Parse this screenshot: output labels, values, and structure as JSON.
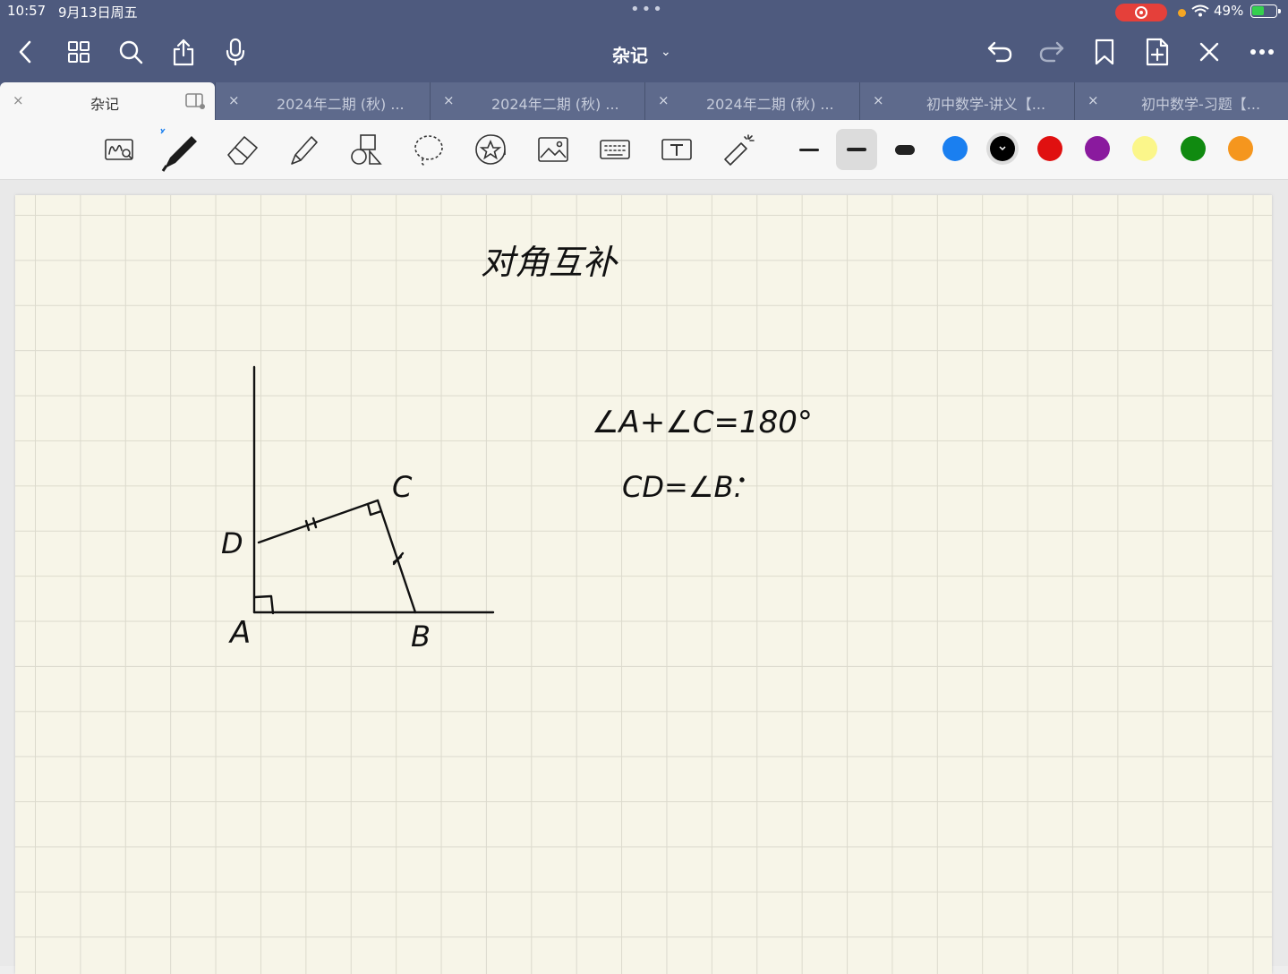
{
  "status": {
    "time": "10:57",
    "date": "9月13日周五",
    "battery": "49%"
  },
  "nav": {
    "title": "杂记",
    "title_caret": "⌄"
  },
  "tabs": [
    {
      "label": "杂记",
      "active": true
    },
    {
      "label": "2024年二期 (秋) ...",
      "active": false
    },
    {
      "label": "2024年二期 (秋) ...",
      "active": false
    },
    {
      "label": "2024年二期 (秋) ...",
      "active": false
    },
    {
      "label": "初中数学-讲义【...",
      "active": false
    },
    {
      "label": "初中数学-习题【...",
      "active": false
    }
  ],
  "tab_close": "×",
  "toolbar": {
    "tools": [
      "handwriting-recognition-icon",
      "pen-icon",
      "eraser-icon",
      "highlighter-icon",
      "shapes-icon",
      "lasso-icon",
      "sticker-icon",
      "image-icon",
      "keyboard-icon",
      "text-box-icon",
      "laser-pointer-icon"
    ],
    "selected_tool": "pen-icon",
    "stroke_widths": [
      "thin",
      "medium",
      "thick"
    ],
    "selected_stroke": "medium",
    "colors": [
      "#1a7ff0",
      "#000000",
      "#e01010",
      "#8a1a9e",
      "#fbf68a",
      "#108a10",
      "#f5961e"
    ],
    "selected_color": "#000000"
  },
  "notes": {
    "title": "对角互补",
    "eq1": "∠A+∠C=180°",
    "eq2": "CD=∠B.",
    "labels": {
      "A": "A",
      "B": "B",
      "C": "C",
      "D": "D"
    }
  }
}
